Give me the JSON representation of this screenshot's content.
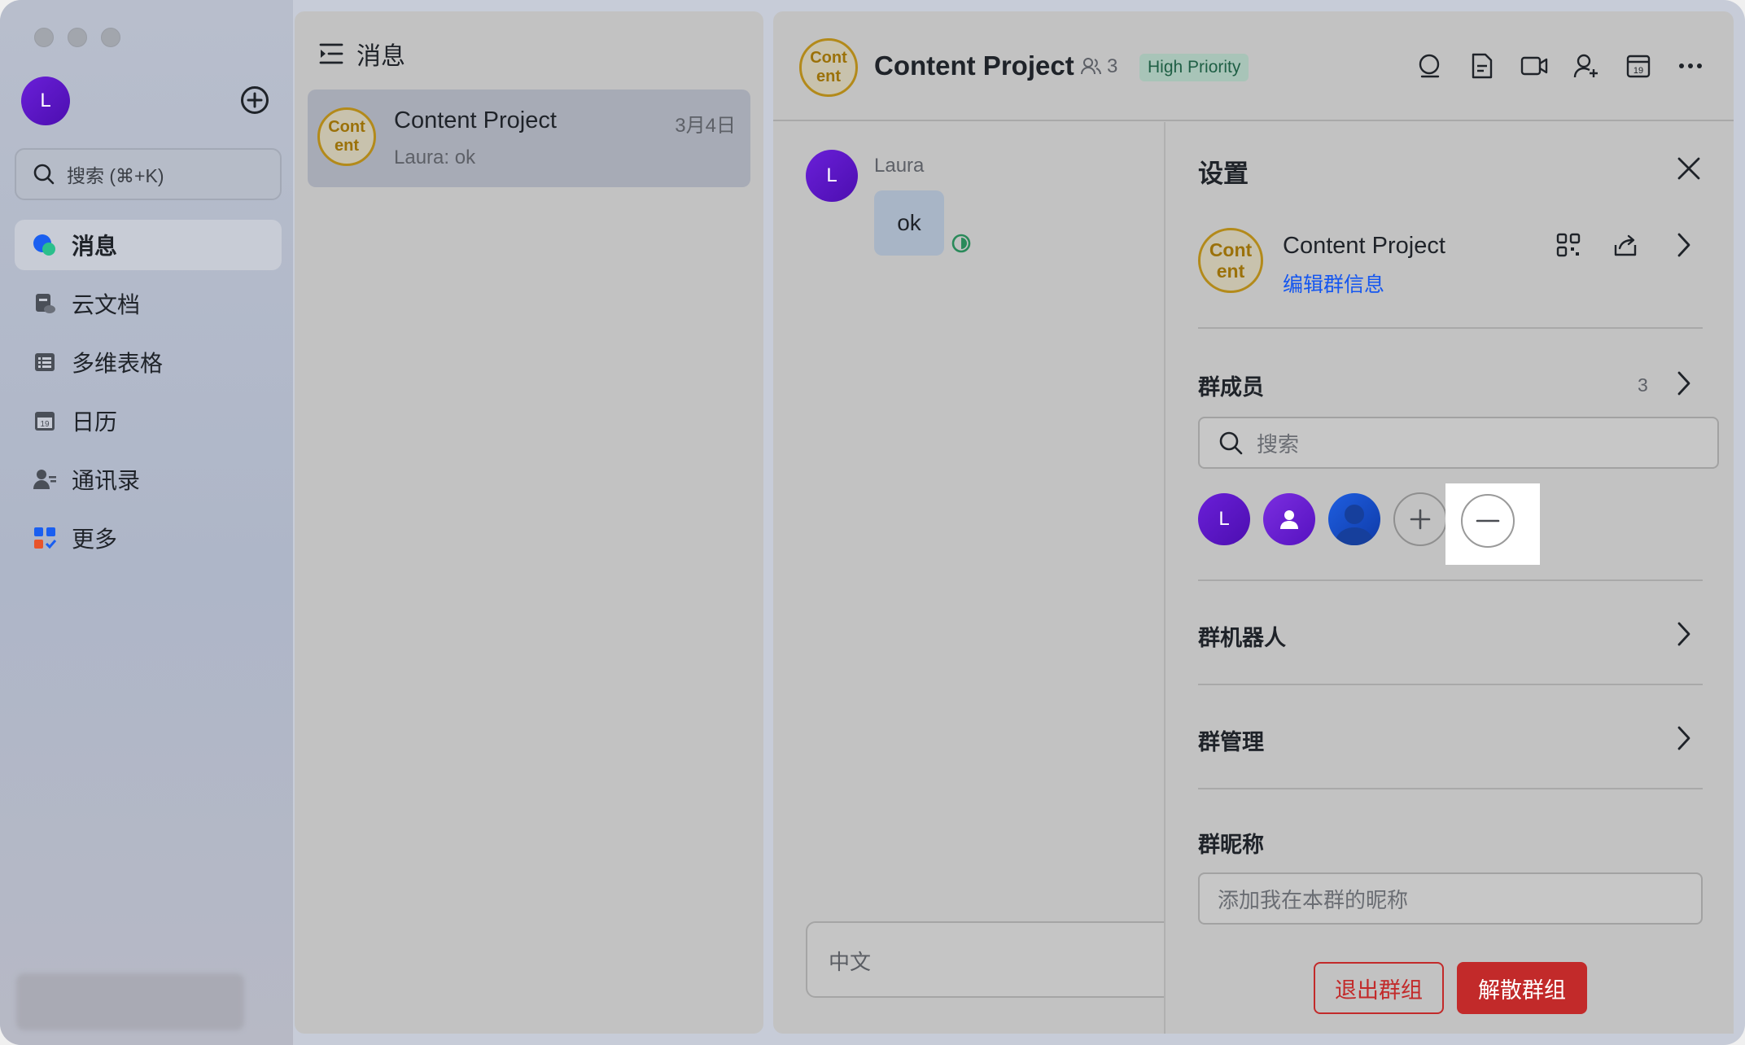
{
  "sidebar": {
    "avatar_initial": "L",
    "search_placeholder": "搜索 (⌘+K)",
    "nav": [
      {
        "label": "消息",
        "icon": "chat-bubbles-icon",
        "active": true
      },
      {
        "label": "云文档",
        "icon": "cloud-docs-icon"
      },
      {
        "label": "多维表格",
        "icon": "base-table-icon"
      },
      {
        "label": "日历",
        "icon": "calendar-icon"
      },
      {
        "label": "通讯录",
        "icon": "contacts-icon"
      },
      {
        "label": "更多",
        "icon": "more-apps-icon"
      }
    ]
  },
  "chat_list": {
    "title": "消息",
    "items": [
      {
        "avatar_text": "Cont ent",
        "name": "Content Project",
        "date": "3月4日",
        "preview": "Laura: ok"
      }
    ]
  },
  "chat": {
    "avatar_text": "Cont ent",
    "title": "Content Project",
    "member_count": "3",
    "priority_tag": "High Priority",
    "messages": [
      {
        "sender_initial": "L",
        "sender": "Laura",
        "text": "ok"
      }
    ],
    "input_placeholder": "中文"
  },
  "settings": {
    "title": "设置",
    "group_avatar_text": "Cont ent",
    "group_name": "Content Project",
    "edit_link": "编辑群信息",
    "members_label": "群成员",
    "members_count": "3",
    "member_search_placeholder": "搜索",
    "member_initial": "L",
    "bots_label": "群机器人",
    "manage_label": "群管理",
    "nickname_label": "群昵称",
    "nickname_placeholder": "添加我在本群的昵称",
    "leave_button": "退出群组",
    "disband_button": "解散群组"
  },
  "colors": {
    "accent_purple": "#5a14c8",
    "link_blue": "#1456f0",
    "danger_red": "#c22a2a",
    "group_avatar_gold": "#b38a1a",
    "tag_green_bg": "#a8c4b8"
  }
}
